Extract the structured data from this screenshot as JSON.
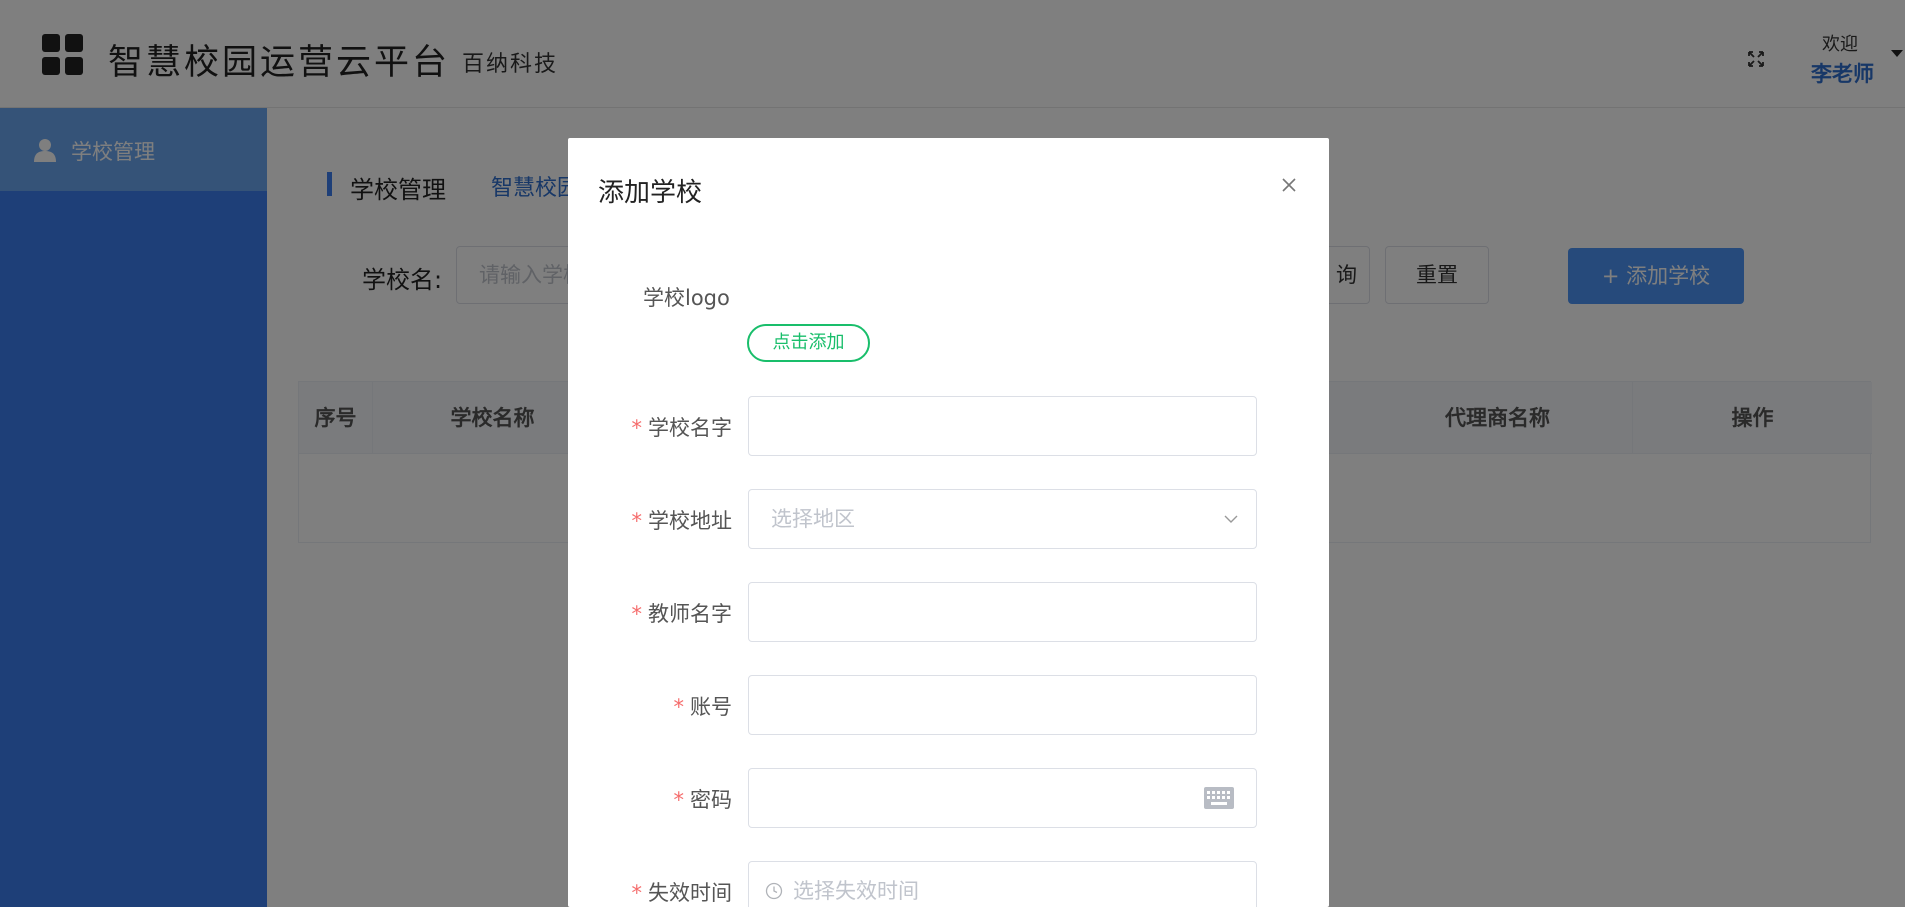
{
  "header": {
    "title": "智慧校园运营云平台",
    "subtitle": "百纳科技",
    "welcome": "欢迎",
    "user_name": "李老师",
    "icons": {
      "logo": "grid-logo-icon",
      "fullscreen": "fullscreen-icon",
      "user_menu": "caret-down-icon"
    }
  },
  "sidebar": {
    "items": [
      {
        "label": "学校管理",
        "icon": "person-icon"
      }
    ]
  },
  "main": {
    "breadcrumb": {
      "title": "学校管理",
      "link": "智慧校园"
    },
    "filter": {
      "label": "学校名:",
      "placeholder": "请输入学校",
      "query_label_partial": "询",
      "reset_label": "重置",
      "add_label": "+ 添加学校"
    },
    "table": {
      "columns": [
        "序号",
        "学校名称",
        "代理商名称",
        "操作"
      ]
    }
  },
  "dialog": {
    "title": "添加学校",
    "logo_label": "学校logo",
    "upload_label": "点击添加",
    "fields": [
      {
        "label": "学校名字",
        "required": "*",
        "value": ""
      },
      {
        "label": "学校地址",
        "required": "*",
        "placeholder": "选择地区"
      },
      {
        "label": "教师名字",
        "required": "*",
        "value": ""
      },
      {
        "label": "账号",
        "required": "*",
        "value": ""
      },
      {
        "label": "密码",
        "required": "*",
        "value": ""
      },
      {
        "label": "失效时间",
        "required": "*",
        "placeholder": "选择失效时间"
      }
    ]
  },
  "colors": {
    "primary": "#3d7ff0",
    "link": "#2f6fcf",
    "success": "#19be6b",
    "danger": "#f56c6c",
    "overlay": "rgba(0,0,0,0.5)"
  }
}
